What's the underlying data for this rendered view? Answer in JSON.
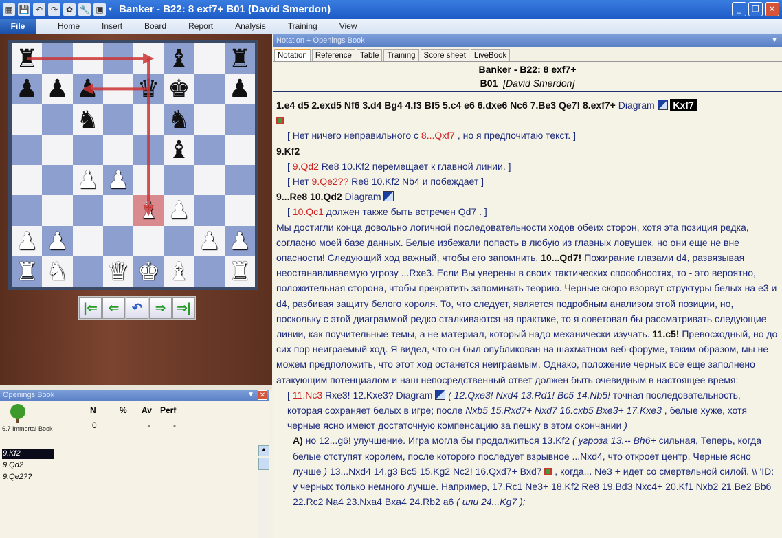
{
  "window": {
    "title": "Banker - B22: 8 exf7+  B01  (David Smerdon)",
    "controls": [
      "minimize",
      "restore",
      "close"
    ]
  },
  "quick_access": [
    "app-icon",
    "save-icon",
    "undo-icon",
    "redo-icon",
    "engine-icon",
    "tools-icon",
    "board-icon",
    "dropdown-icon"
  ],
  "menu": {
    "file": "File",
    "items": [
      "Home",
      "Insert",
      "Board",
      "Report",
      "Analysis",
      "Training",
      "View"
    ]
  },
  "board": {
    "ranks": [
      [
        "r",
        "",
        "",
        "",
        "",
        "b",
        "",
        "r"
      ],
      [
        "p",
        "p",
        "p",
        "",
        "q",
        "k",
        "",
        "p"
      ],
      [
        "",
        "",
        "n",
        "",
        "",
        "n",
        "",
        ""
      ],
      [
        "",
        "",
        "",
        "",
        "",
        "b",
        "",
        ""
      ],
      [
        "",
        "",
        "P",
        "P",
        "",
        "",
        "",
        ""
      ],
      [
        "",
        "",
        "",
        "",
        "B",
        "P",
        "",
        ""
      ],
      [
        "P",
        "P",
        "",
        "",
        "",
        "",
        "P",
        "P"
      ],
      [
        "R",
        "N",
        "",
        "Q",
        "K",
        "B",
        "",
        "R"
      ]
    ],
    "highlight": "e3",
    "arrows": [
      [
        "a8",
        "e8"
      ],
      [
        "e8",
        "e3"
      ],
      [
        "e7",
        "c7"
      ]
    ],
    "square_colors": {
      "light": "#f4f4f6",
      "dark": "#8c9fce"
    }
  },
  "nav_buttons": [
    "first",
    "back",
    "takeback",
    "forward",
    "last"
  ],
  "openings_book": {
    "title": "Openings Book",
    "book_name": "6.7 Immortal-Book",
    "columns": [
      "N",
      "%",
      "Av",
      "Perf"
    ],
    "values": [
      "0",
      "",
      "-",
      "-"
    ],
    "moves": [
      "9.Kf2",
      "9.Qd2",
      "9.Qe2??"
    ],
    "selected": 0
  },
  "notation_panel": {
    "title": "Notation + Openings Book",
    "tabs": [
      "Notation",
      "Reference",
      "Table",
      "Training",
      "Score sheet",
      "LiveBook"
    ],
    "active_tab": 0,
    "header": {
      "line1": "Banker - B22: 8 exf7+",
      "eco": "B01",
      "annotator": "[David Smerdon]"
    },
    "diagram": "Diagram",
    "l1": [
      "1.e4",
      "d5",
      "2.exd5",
      "Nf6",
      "3.d4",
      "Bg4",
      "4.f3",
      "Bf5",
      "5.c4",
      "e6",
      "6.dxe6",
      "Nc6",
      "7.Be3",
      "Qe7!",
      "8.exf7+"
    ],
    "l1cur": "Kxf7",
    "c1a": "[ Нет ничего неправильного с ",
    "c1m": "8...Qxf7",
    "c1b": " , но я предпочитаю текст. ]",
    "m9": "9.Kf2",
    "v1": {
      "a": "[ ",
      "m1": "9.Qd2",
      "b": "  Re8  10.Kf2 перемещает к главной линии. ]"
    },
    "v2": {
      "a": "[ Нет ",
      "m1": "9.Qe2??",
      "b": "  Re8  10.Kf2  Nb4 и побеждает ]"
    },
    "m10": "9...Re8  10.Qd2",
    "v3": {
      "a": "[ ",
      "m1": "10.Qc1",
      "b": " должен также быть встречен  Qd7 . ]"
    },
    "para1": "Мы достигли конца довольно логичной последовательности ходов обеих сторон, хотя эта позиция редка, согласно моей базе данных. Белые избежали попасть в любую из главных ловушек, но они еще не вне опасности! Следующий ход важный, чтобы его запомнить. ",
    "para1m": "10...Qd7!",
    "para2": " Пожирание глазами d4, развязывая неостанавливаемую угрозу ...Rxe3. Если Вы уверены в своих тактических способностях, то - это вероятно, положительная сторона, чтобы прекратить запоминать теорию. Черные скоро взорвут структуры белых на e3 и d4, разбивая  защиту белого короля. То, что следует, является подробным анализом этой позиции, но, поскольку с этой диаграммой редко сталкиваются на практике, то я советовал бы рассматривать следующие линии, как поучительные темы, а не материал, который надо механически изучать. ",
    "para2m": "11.c5!",
    "para3": " Превосходный, но до сих пор неиграемый ход. Я видел, что он был опубликован на шахматном веб-форуме, таким образом, мы не можем предположить, что этот ход останется неиграемым. Однако, положение черных все еще заполнено атакующим потенциалом и наш непосредственный ответ должен быть очевидным в настоящее время:",
    "v4": {
      "a": "[ ",
      "m1": "11.Nc3",
      "b": "  Rxe3!  12.Kxe3? ",
      "c": " ( 12.Qxe3!  Nxd4  13.Rd1!  Bc5  14.Nb5!",
      "d": " точная последовательность, которая сохраняет белых в игре; после ",
      "e": " Nxb5  15.Rxd7+  Nxd7  16.cxb5  Bxe3+  17.Kxe3",
      "f": " , белые хуже, хотя черные ясно имеют достаточную компенсацию за пешку в этом окончании ",
      "g": ")"
    },
    "vA": {
      "label": "A)",
      "a": "  но ",
      "m": "12...g6!",
      "b": " улучшение.  Игра могла бы продолжиться 13.Kf2 ",
      "c": " ( угроза ",
      "d": "13.--  Bh6+",
      "e": " сильная, Теперь, когда белые отступят королем, после которого последует взрывное ...Nxd4, что откроет центр. Черные ясно лучше ",
      "f": ")",
      "g": " 13...Nxd4  14.g3  Bc5  15.Kg2  Nc2!  16.Qxd7+  Bxd7 ",
      "h": " , когда... Ne3 + идет со смертельной силой. \\\\ 'ID: у черных только немного лучше. Например,  17.Rc1  Ne3+  18.Kf2  Re8  19.Bd3  Nxc4+  20.Kf1  Nxb2  21.Be2  Bb6  22.Rc2  Na4  23.Nxa4  Bxa4  24.Rb2  a6 ",
      "i": "( или 24...Kg7 );"
    }
  }
}
